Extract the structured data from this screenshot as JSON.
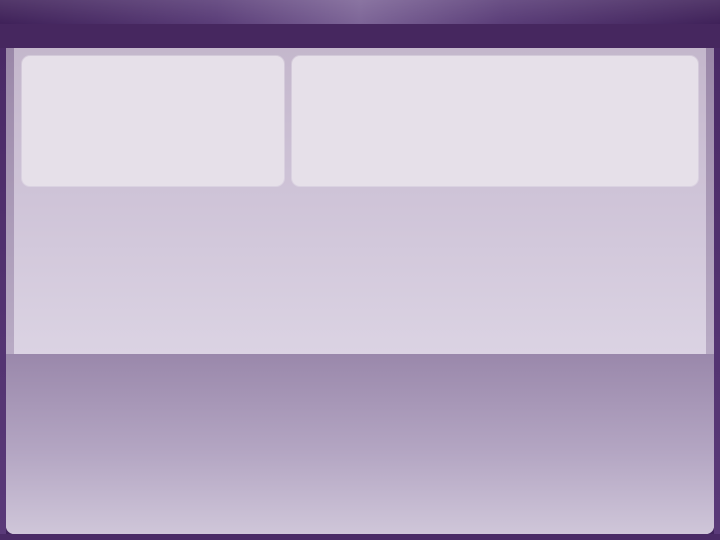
{
  "window": {
    "title": ""
  },
  "panels": {
    "left_card": {
      "label": ""
    },
    "right_card": {
      "label": ""
    }
  },
  "colors": {
    "frame": "#4b2c68",
    "titlebar_highlight": "#7d6597",
    "panel_top": "#c4b7cc",
    "card_fill": "#e6e0e9",
    "lower_area_bottom": "#cfc6d9"
  }
}
